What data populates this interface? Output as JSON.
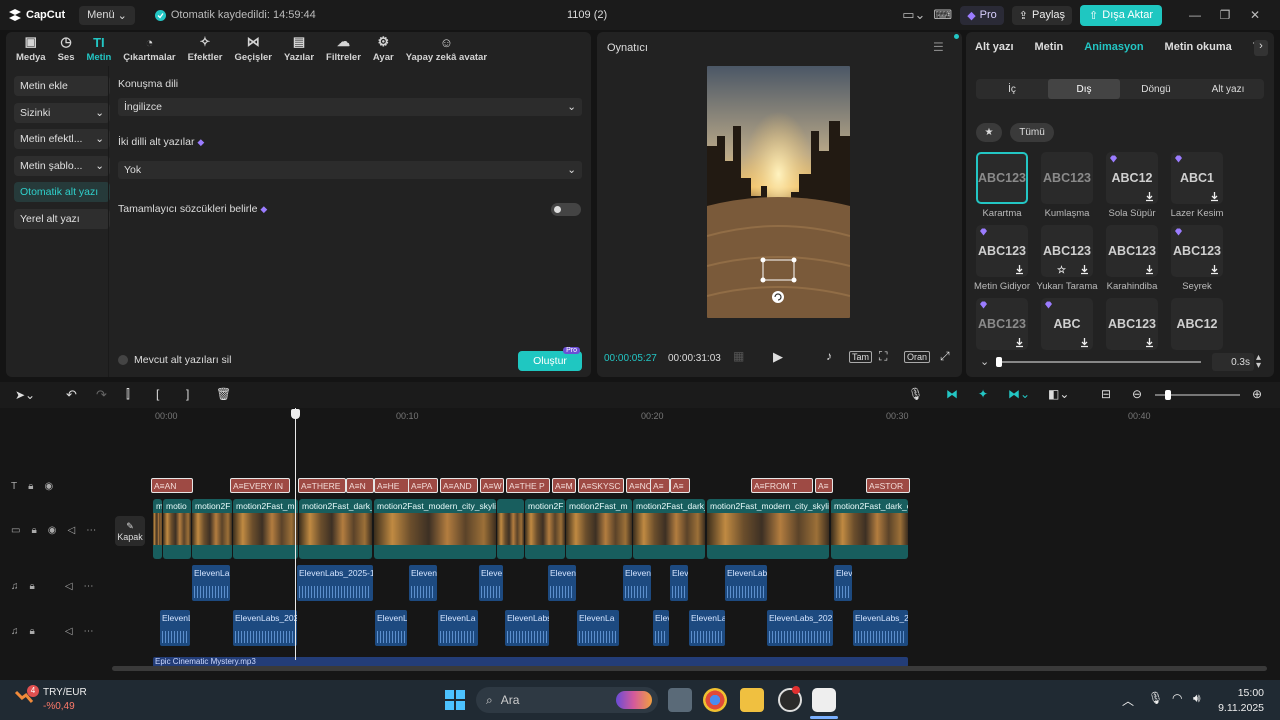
{
  "titlebar": {
    "logo": "CapCut",
    "menu": "Menü",
    "autosave": "Otomatik kaydedildi: 14:59:44",
    "project": "1109 (2)",
    "pro": "Pro",
    "share": "Paylaş",
    "export": "Dışa Aktar"
  },
  "toolbar": [
    {
      "label": "Medya",
      "icon": "media-icon"
    },
    {
      "label": "Ses",
      "icon": "audio-icon"
    },
    {
      "label": "Metin",
      "icon": "text-icon"
    },
    {
      "label": "Çıkartmalar",
      "icon": "sticker-icon"
    },
    {
      "label": "Efektler",
      "icon": "effects-icon"
    },
    {
      "label": "Geçişler",
      "icon": "transitions-icon"
    },
    {
      "label": "Yazılar",
      "icon": "captions-icon"
    },
    {
      "label": "Filtreler",
      "icon": "filters-icon"
    },
    {
      "label": "Ayar",
      "icon": "adjust-icon"
    },
    {
      "label": "Yapay zekâ avatar",
      "icon": "ai-avatar-icon"
    }
  ],
  "subnav": [
    {
      "label": "Metin ekle"
    },
    {
      "label": "Sizinki"
    },
    {
      "label": "Metin efektl..."
    },
    {
      "label": "Metin şablo..."
    },
    {
      "label": "Otomatik alt yazı"
    },
    {
      "label": "Yerel alt yazı"
    }
  ],
  "captions": {
    "lang_label": "Konuşma dili",
    "lang_value": "İngilizce",
    "bilingual_label": "İki dilli alt yazılar",
    "bilingual_value": "Yok",
    "filler_label": "Tamamlayıcı sözcükleri belirle",
    "clear_label": "Mevcut alt yazıları sil",
    "create": "Oluştur",
    "pro_badge": "Pro"
  },
  "player": {
    "title": "Oynatıcı",
    "current": "00:00:05:27",
    "total": "00:00:31:03",
    "full": "Tam",
    "ratio": "Oran"
  },
  "right": {
    "tabs": [
      "Alt yazı",
      "Metin",
      "Animasyon",
      "Metin okuma",
      "YZ"
    ],
    "segments": [
      "İç",
      "Dış",
      "Döngü",
      "Alt yazı"
    ],
    "filter_all": "Tümü",
    "cards": [
      {
        "text": "ABC123",
        "name": "Karartma"
      },
      {
        "text": "ABC123",
        "name": "Kumlaşma"
      },
      {
        "text": "ABC12",
        "name": "Sola Süpür"
      },
      {
        "text": "ABC1",
        "name": "Lazer Kesim"
      },
      {
        "text": "ABC123",
        "name": "Metin Gidiyor"
      },
      {
        "text": "ABC123",
        "name": "Yukarı Tarama"
      },
      {
        "text": "ABC123",
        "name": "Karahindiba"
      },
      {
        "text": "ABC123",
        "name": "Seyrek"
      },
      {
        "text": "ABC123",
        "name": ""
      },
      {
        "text": "ABC",
        "name": ""
      },
      {
        "text": "ABC123",
        "name": ""
      },
      {
        "text": "ABC12",
        "name": ""
      }
    ],
    "duration": "0.3s",
    "duration_fraction": 0.0
  },
  "timeline": {
    "ruler": [
      "00:00",
      "00:10",
      "00:20",
      "00:30",
      "00:40"
    ],
    "cover": "Kapak",
    "text_clips": [
      "AN",
      "EVERY IN",
      "THERE",
      "N",
      "HE",
      "PA",
      "AND",
      "W",
      "THE P",
      "M",
      "SKYSC",
      "NO",
      "",
      "",
      "FROM T",
      "",
      "STOR"
    ],
    "video_clips": [
      "m",
      "motio",
      "motion2F",
      "motion2Fast_m",
      "motion2Fast_dark_",
      "motion2Fast_modern_city_skyli",
      "",
      "motion2F",
      "motion2Fast_m",
      "motion2Fast_dark_",
      "motion2Fast_modern_city_skyli",
      "motion2Fast_dark_c"
    ],
    "audio1": [
      "ElevenLab",
      "ElevenLabs_2025-1",
      "Eleven",
      "Eleve",
      "Eleven",
      "Eleven",
      "Elev",
      "ElevenLab",
      "Elev"
    ],
    "audio2": [
      "ElevenL",
      "ElevenLabs_202",
      "ElevenL",
      "ElevenLa",
      "ElevenLabs",
      "ElevenLa",
      "Elev",
      "ElevenLa",
      "ElevenLabs_202",
      "ElevenLabs_2"
    ],
    "music": "Epic Cinematic Mystery.mp3"
  },
  "taskbar": {
    "ticker": "TRY/EUR",
    "change": "-%0,49",
    "badge": "4",
    "search": "Ara",
    "time": "15:00",
    "date": "9.11.2025"
  },
  "colors": {
    "accent": "#1fc7c1",
    "text_clip": "#9e4a44",
    "video_clip": "#185e5e",
    "audio_clip": "#1d4a80"
  }
}
